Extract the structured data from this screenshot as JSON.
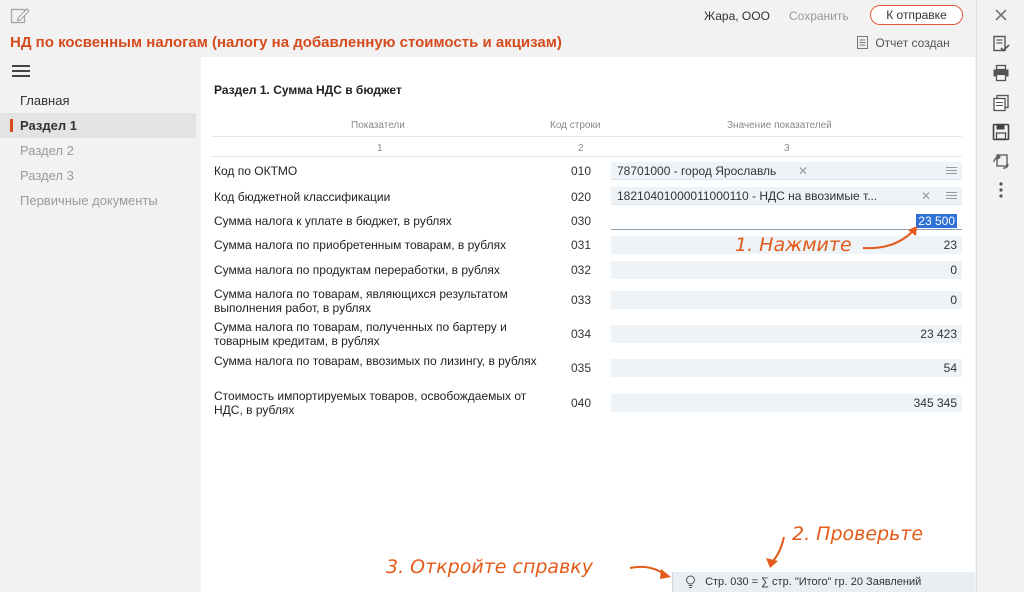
{
  "header": {
    "org_name": "Жара, ООО",
    "save_label": "Сохранить",
    "send_label": "К отправке"
  },
  "document": {
    "title": "НД по косвенным налогам (налогу на добавленную стоимость и акцизам)",
    "status": "Отчет создан"
  },
  "nav": {
    "items": [
      {
        "label": "Главная"
      },
      {
        "label": "Раздел 1"
      },
      {
        "label": "Раздел 2"
      },
      {
        "label": "Раздел 3"
      },
      {
        "label": "Первичные документы"
      }
    ]
  },
  "section": {
    "title": "Раздел 1. Сумма НДС в бюджет",
    "columns": [
      "Показатели",
      "Код строки",
      "Значение показателей"
    ],
    "column_numbers": [
      "1",
      "2",
      "3"
    ],
    "rows": [
      {
        "label": "Код по ОКТМО",
        "code": "010",
        "value": "78701000 - город Ярославль"
      },
      {
        "label": "Код бюджетной классификации",
        "code": "020",
        "value": "18210401000011000110 - НДС на ввозимые т..."
      },
      {
        "label": "Сумма налога к уплате в бюджет, в рублях",
        "code": "030",
        "value": "23 500"
      },
      {
        "label": "Сумма налога по приобретенным товарам, в рублях",
        "code": "031",
        "value": "23"
      },
      {
        "label": "Сумма налога по продуктам переработки, в рублях",
        "code": "032",
        "value": "0"
      },
      {
        "label": "Сумма налога по товарам, являющихся результатом выполнения работ, в рублях",
        "code": "033",
        "value": "0"
      },
      {
        "label": "Сумма налога по товарам, полученных по бартеру и товарным кредитам, в рублях",
        "code": "034",
        "value": "23 423"
      },
      {
        "label": "Сумма налога по товарам, ввозимых по лизингу, в рублях",
        "code": "035",
        "value": "54"
      },
      {
        "label": "Стоимость импортируемых товаров, освобождаемых от НДС, в рублях",
        "code": "040",
        "value": "345 345"
      }
    ]
  },
  "annotations": {
    "step1": "1. Нажмите",
    "step2": "2. Проверьте",
    "step3": "3. Откройте справку"
  },
  "hint": {
    "text": "Стр. 030 = ∑ стр. \"Итого\" гр. 20 Заявлений"
  },
  "colors": {
    "accent": "#d64a1c",
    "annotation": "#e45a18",
    "field_bg": "#eef3f7",
    "selection": "#2f70d6"
  },
  "icons": {
    "top_left": "edit-icon",
    "status": "document-icon",
    "menu": "hamburger-icon",
    "hint": "lightbulb-icon",
    "right_toolbar": [
      "close-icon",
      "checklist-icon",
      "print-icon",
      "documents-icon",
      "save-icon",
      "refresh-docs-icon",
      "more-vertical-icon"
    ]
  }
}
